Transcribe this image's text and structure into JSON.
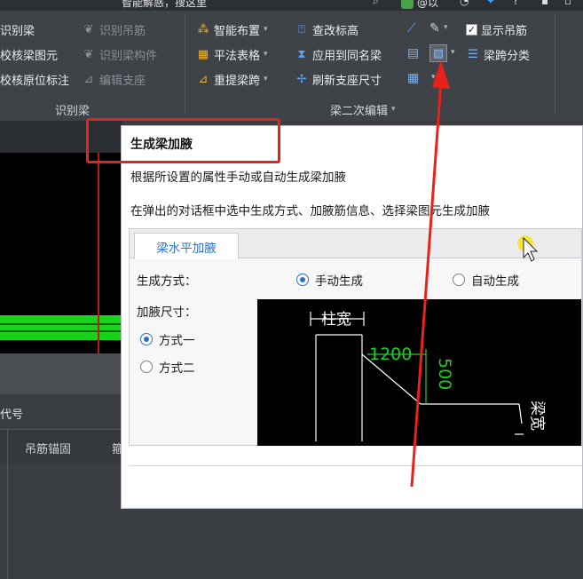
{
  "titlebar": {
    "hint": "智能解惑，搜这里",
    "user": "@以"
  },
  "ribbon": {
    "group1": {
      "items": [
        {
          "label": "识别梁",
          "state": "enabled"
        },
        {
          "label": "校核梁图元",
          "state": "enabled"
        },
        {
          "label": "校核原位标注",
          "state": "enabled"
        },
        {
          "label": "识别吊筋",
          "state": "disabled"
        },
        {
          "label": "识别梁构件",
          "state": "disabled"
        },
        {
          "label": "编辑支座",
          "state": "disabled"
        }
      ],
      "group_label": "识别梁"
    },
    "group2": {
      "items": [
        {
          "label": "智能布置",
          "has_dropdown": true
        },
        {
          "label": "平法表格",
          "has_dropdown": true
        },
        {
          "label": "重提梁跨",
          "has_dropdown": true
        },
        {
          "label": "查改标高"
        },
        {
          "label": "应用到同名梁"
        },
        {
          "label": "刷新支座尺寸"
        }
      ],
      "show_hanger_label": "显示吊筋",
      "span_classify_label": "梁跨分类",
      "group_label": "梁二次编辑"
    }
  },
  "left_panel": {
    "section_title": "代号",
    "column_header": "吊筋锚固",
    "column_header_partial": "箍"
  },
  "tooltip": {
    "title": "生成梁加腋",
    "line1": "根据所设置的属性手动或自动生成梁加腋",
    "line2": "在弹出的对话框中选中生成方式、加腋筋信息、选择梁图元生成加腋",
    "tab": "梁水平加腋",
    "mode_label": "生成方式：",
    "mode_manual": "手动生成",
    "mode_auto": "自动生成",
    "size_label": "加腋尺寸：",
    "option1": "方式一",
    "option2": "方式二",
    "diagram": {
      "column_width_label": "柱宽",
      "haunch_length": "1200",
      "haunch_height": "500",
      "beam_width_label": "梁宽"
    }
  },
  "colors": {
    "annotation_red": "#e8221b",
    "accent_blue": "#2d6fd1",
    "diagram_green": "#18d418",
    "cursor_highlight": "#f6e427"
  }
}
